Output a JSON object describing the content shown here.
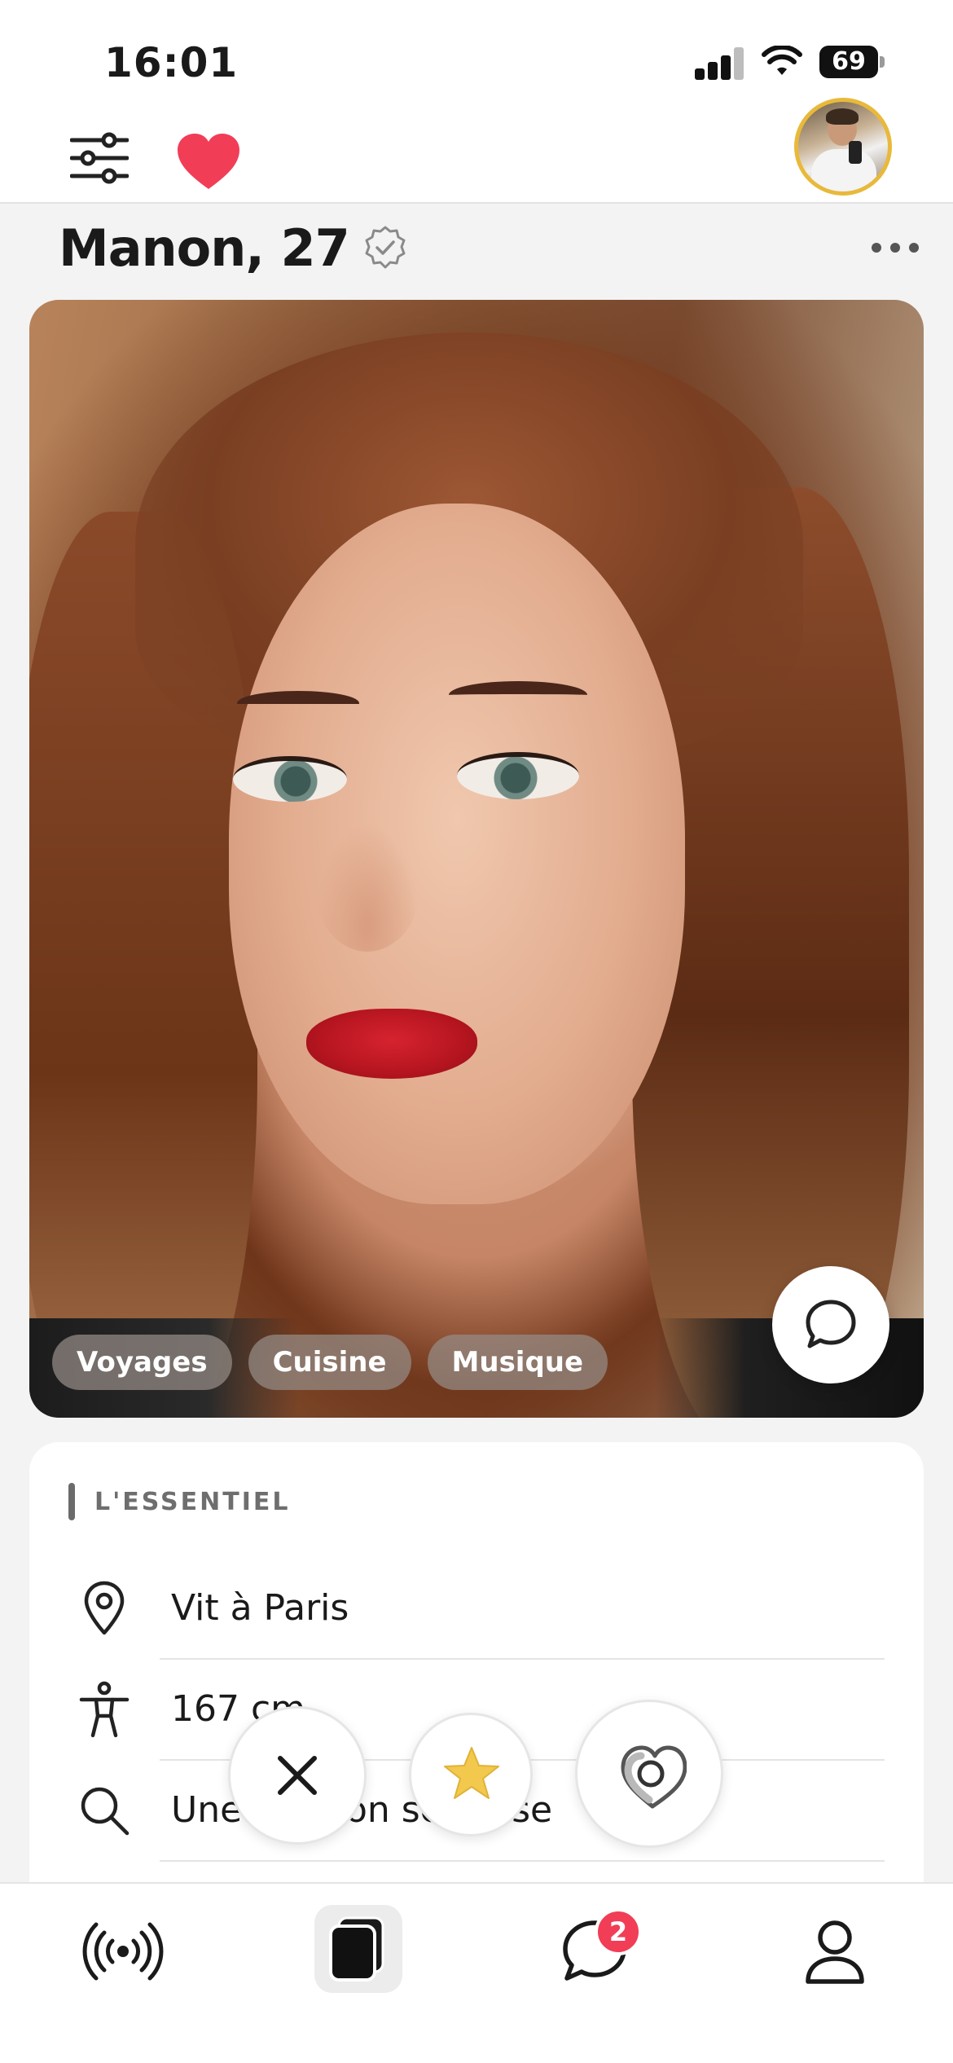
{
  "status_bar": {
    "time": "16:01",
    "battery_level": "69"
  },
  "header": {
    "filters_icon": "sliders-icon",
    "likes_icon": "heart-icon",
    "avatar_icon": "user-avatar"
  },
  "profile": {
    "name_age": "Manon, 27",
    "verified_icon": "verified-badge-icon",
    "more_icon": "ellipsis-icon",
    "tags": [
      "Voyages",
      "Cuisine",
      "Musique"
    ]
  },
  "essentials": {
    "title": "L'ESSENTIEL",
    "rows": [
      {
        "icon": "location-pin-icon",
        "text": "Vit à Paris"
      },
      {
        "icon": "person-icon",
        "text": "167 cm"
      },
      {
        "icon": "search-icon",
        "text": "Une relation sérieuse"
      }
    ]
  },
  "actions": {
    "pass_icon": "close-icon",
    "super_icon": "star-icon",
    "like_icon": "heart-outline-icon"
  },
  "tabbar": {
    "tabs": [
      "live-icon",
      "cards-icon",
      "chat-icon",
      "profile-icon"
    ],
    "chat_badge": "2"
  },
  "colors": {
    "accent_red": "#f23d57",
    "avatar_ring": "#e8b93a",
    "star": "#f2c94c"
  }
}
